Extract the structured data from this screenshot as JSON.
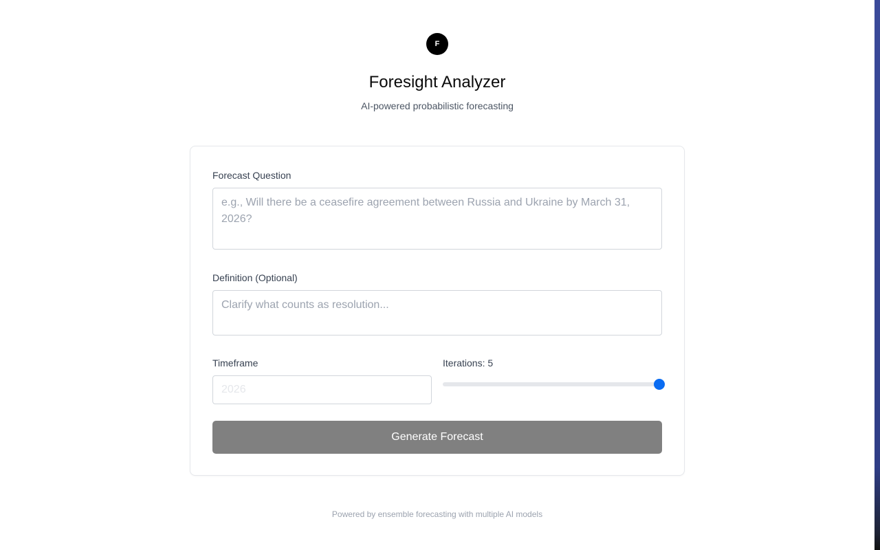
{
  "header": {
    "logo_letter": "F",
    "title": "Foresight Analyzer",
    "subtitle": "AI-powered probabilistic forecasting"
  },
  "form": {
    "question": {
      "label": "Forecast Question",
      "value": "",
      "placeholder": "e.g., Will there be a ceasefire agreement between Russia and Ukraine by March 31, 2026?"
    },
    "definition": {
      "label": "Definition (Optional)",
      "value": "",
      "placeholder": "Clarify what counts as resolution..."
    },
    "timeframe": {
      "label": "Timeframe",
      "value": "",
      "placeholder": "2026"
    },
    "iterations": {
      "label": "Iterations: 5",
      "value": 5,
      "min": 1,
      "max": 5
    },
    "submit_label": "Generate Forecast"
  },
  "footer": {
    "text": "Powered by ensemble forecasting with multiple AI models"
  },
  "colors": {
    "accent": "#0a6cf2",
    "button_disabled": "#808080",
    "edge_strip": "#2f3d86"
  }
}
